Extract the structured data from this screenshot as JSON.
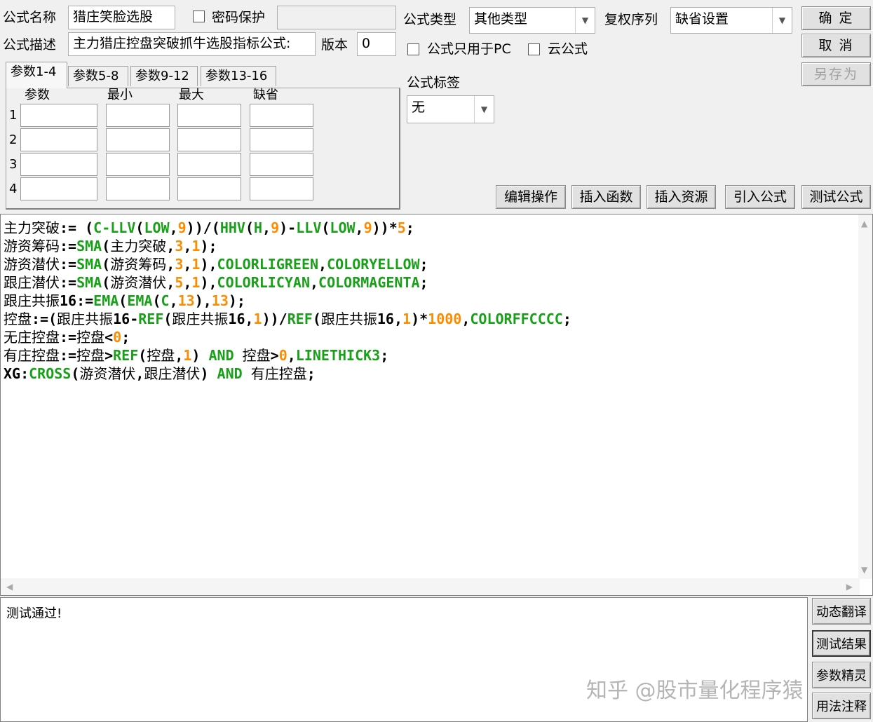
{
  "formula": {
    "name_label": "公式名称",
    "name_value": "猎庄笑脸选股",
    "password_label": "密码保护",
    "password_value": "",
    "desc_label": "公式描述",
    "desc_value": "主力猎庄控盘突破抓牛选股指标公式:",
    "version_label": "版本",
    "version_value": "0",
    "type_label": "公式类型",
    "type_value": "其他类型",
    "restore_label": "复权序列",
    "restore_value": "缺省设置",
    "pc_only_label": "公式只用于PC",
    "cloud_label": "云公式",
    "tag_label": "公式标签",
    "tag_value": "无"
  },
  "buttons": {
    "ok": "确 定",
    "cancel": "取 消",
    "save_as": "另存为",
    "edit_ops": "编辑操作",
    "insert_func": "插入函数",
    "insert_res": "插入资源",
    "import_formula": "引入公式",
    "test_formula": "测试公式"
  },
  "params": {
    "tabs": [
      "参数1-4",
      "参数5-8",
      "参数9-12",
      "参数13-16"
    ],
    "headers": [
      "参数",
      "最小",
      "最大",
      "缺省"
    ],
    "rows": [
      "1",
      "2",
      "3",
      "4"
    ]
  },
  "code": {
    "lines": [
      [
        [
          "id",
          "主力突破"
        ],
        [
          "op",
          ":= ("
        ],
        [
          "fn",
          "C-LLV"
        ],
        [
          "op",
          "("
        ],
        [
          "fn",
          "LOW"
        ],
        [
          "op",
          ","
        ],
        [
          "num",
          "9"
        ],
        [
          "op",
          "))/("
        ],
        [
          "fn",
          "HHV"
        ],
        [
          "op",
          "("
        ],
        [
          "fn",
          "H"
        ],
        [
          "op",
          ","
        ],
        [
          "num",
          "9"
        ],
        [
          "op",
          ")-"
        ],
        [
          "fn",
          "LLV"
        ],
        [
          "op",
          "("
        ],
        [
          "fn",
          "LOW"
        ],
        [
          "op",
          ","
        ],
        [
          "num",
          "9"
        ],
        [
          "op",
          "))*"
        ],
        [
          "num",
          "5"
        ],
        [
          "op",
          ";"
        ]
      ],
      [
        [
          "id",
          "游资筹码"
        ],
        [
          "op",
          ":="
        ],
        [
          "fn",
          "SMA"
        ],
        [
          "op",
          "("
        ],
        [
          "id",
          "主力突破"
        ],
        [
          "op",
          ","
        ],
        [
          "num",
          "3"
        ],
        [
          "op",
          ","
        ],
        [
          "num",
          "1"
        ],
        [
          "op",
          ");"
        ]
      ],
      [
        [
          "id",
          "游资潜伏"
        ],
        [
          "op",
          ":="
        ],
        [
          "fn",
          "SMA"
        ],
        [
          "op",
          "("
        ],
        [
          "id",
          "游资筹码"
        ],
        [
          "op",
          ","
        ],
        [
          "num",
          "3"
        ],
        [
          "op",
          ","
        ],
        [
          "num",
          "1"
        ],
        [
          "op",
          "),"
        ],
        [
          "kw",
          "COLORLIGREEN"
        ],
        [
          "op",
          ","
        ],
        [
          "kw",
          "COLORYELLOW"
        ],
        [
          "op",
          ";"
        ]
      ],
      [
        [
          "id",
          "跟庄潜伏"
        ],
        [
          "op",
          ":="
        ],
        [
          "fn",
          "SMA"
        ],
        [
          "op",
          "("
        ],
        [
          "id",
          "游资潜伏"
        ],
        [
          "op",
          ","
        ],
        [
          "num",
          "5"
        ],
        [
          "op",
          ","
        ],
        [
          "num",
          "1"
        ],
        [
          "op",
          "),"
        ],
        [
          "kw",
          "COLORLICYAN"
        ],
        [
          "op",
          ","
        ],
        [
          "kw",
          "COLORMAGENTA"
        ],
        [
          "op",
          ";"
        ]
      ],
      [
        [
          "id",
          "跟庄共振"
        ],
        [
          "op",
          "16:="
        ],
        [
          "fn",
          "EMA"
        ],
        [
          "op",
          "("
        ],
        [
          "fn",
          "EMA"
        ],
        [
          "op",
          "("
        ],
        [
          "fn",
          "C"
        ],
        [
          "op",
          ","
        ],
        [
          "num",
          "13"
        ],
        [
          "op",
          "),"
        ],
        [
          "num",
          "13"
        ],
        [
          "op",
          ");"
        ]
      ],
      [
        [
          "id",
          "控盘"
        ],
        [
          "op",
          ":=("
        ],
        [
          "id",
          "跟庄共振"
        ],
        [
          "op",
          "16-"
        ],
        [
          "fn",
          "REF"
        ],
        [
          "op",
          "("
        ],
        [
          "id",
          "跟庄共振"
        ],
        [
          "op",
          "16,"
        ],
        [
          "num",
          "1"
        ],
        [
          "op",
          "))/"
        ],
        [
          "fn",
          "REF"
        ],
        [
          "op",
          "("
        ],
        [
          "id",
          "跟庄共振"
        ],
        [
          "op",
          "16,"
        ],
        [
          "num",
          "1"
        ],
        [
          "op",
          ")*"
        ],
        [
          "num",
          "1000"
        ],
        [
          "op",
          ","
        ],
        [
          "kw",
          "COLORFFCCCC"
        ],
        [
          "op",
          ";"
        ]
      ],
      [
        [
          "id",
          "无庄控盘"
        ],
        [
          "op",
          ":="
        ],
        [
          "id",
          "控盘"
        ],
        [
          "op",
          "<"
        ],
        [
          "num",
          "0"
        ],
        [
          "op",
          ";"
        ]
      ],
      [
        [
          "id",
          "有庄控盘"
        ],
        [
          "op",
          ":="
        ],
        [
          "id",
          "控盘"
        ],
        [
          "op",
          ">"
        ],
        [
          "fn",
          "REF"
        ],
        [
          "op",
          "("
        ],
        [
          "id",
          "控盘"
        ],
        [
          "op",
          ","
        ],
        [
          "num",
          "1"
        ],
        [
          "op",
          ") "
        ],
        [
          "kw",
          "AND"
        ],
        [
          "op",
          " "
        ],
        [
          "id",
          "控盘"
        ],
        [
          "op",
          ">"
        ],
        [
          "num",
          "0"
        ],
        [
          "op",
          ","
        ],
        [
          "kw",
          "LINETHICK3"
        ],
        [
          "op",
          ";"
        ]
      ],
      [
        [
          "op",
          "XG:"
        ],
        [
          "fn",
          "CROSS"
        ],
        [
          "op",
          "("
        ],
        [
          "id",
          "游资潜伏"
        ],
        [
          "op",
          ","
        ],
        [
          "id",
          "跟庄潜伏"
        ],
        [
          "op",
          ") "
        ],
        [
          "kw",
          "AND"
        ],
        [
          "op",
          " "
        ],
        [
          "id",
          "有庄控盘"
        ],
        [
          "op",
          ";"
        ]
      ]
    ]
  },
  "output": {
    "text": "测试通过!"
  },
  "side_buttons": {
    "dynamic_translate": "动态翻译",
    "test_result": "测试结果",
    "param_wizard": "参数精灵",
    "usage_notes": "用法注释"
  },
  "watermark": "知乎 @股市量化程序猿"
}
